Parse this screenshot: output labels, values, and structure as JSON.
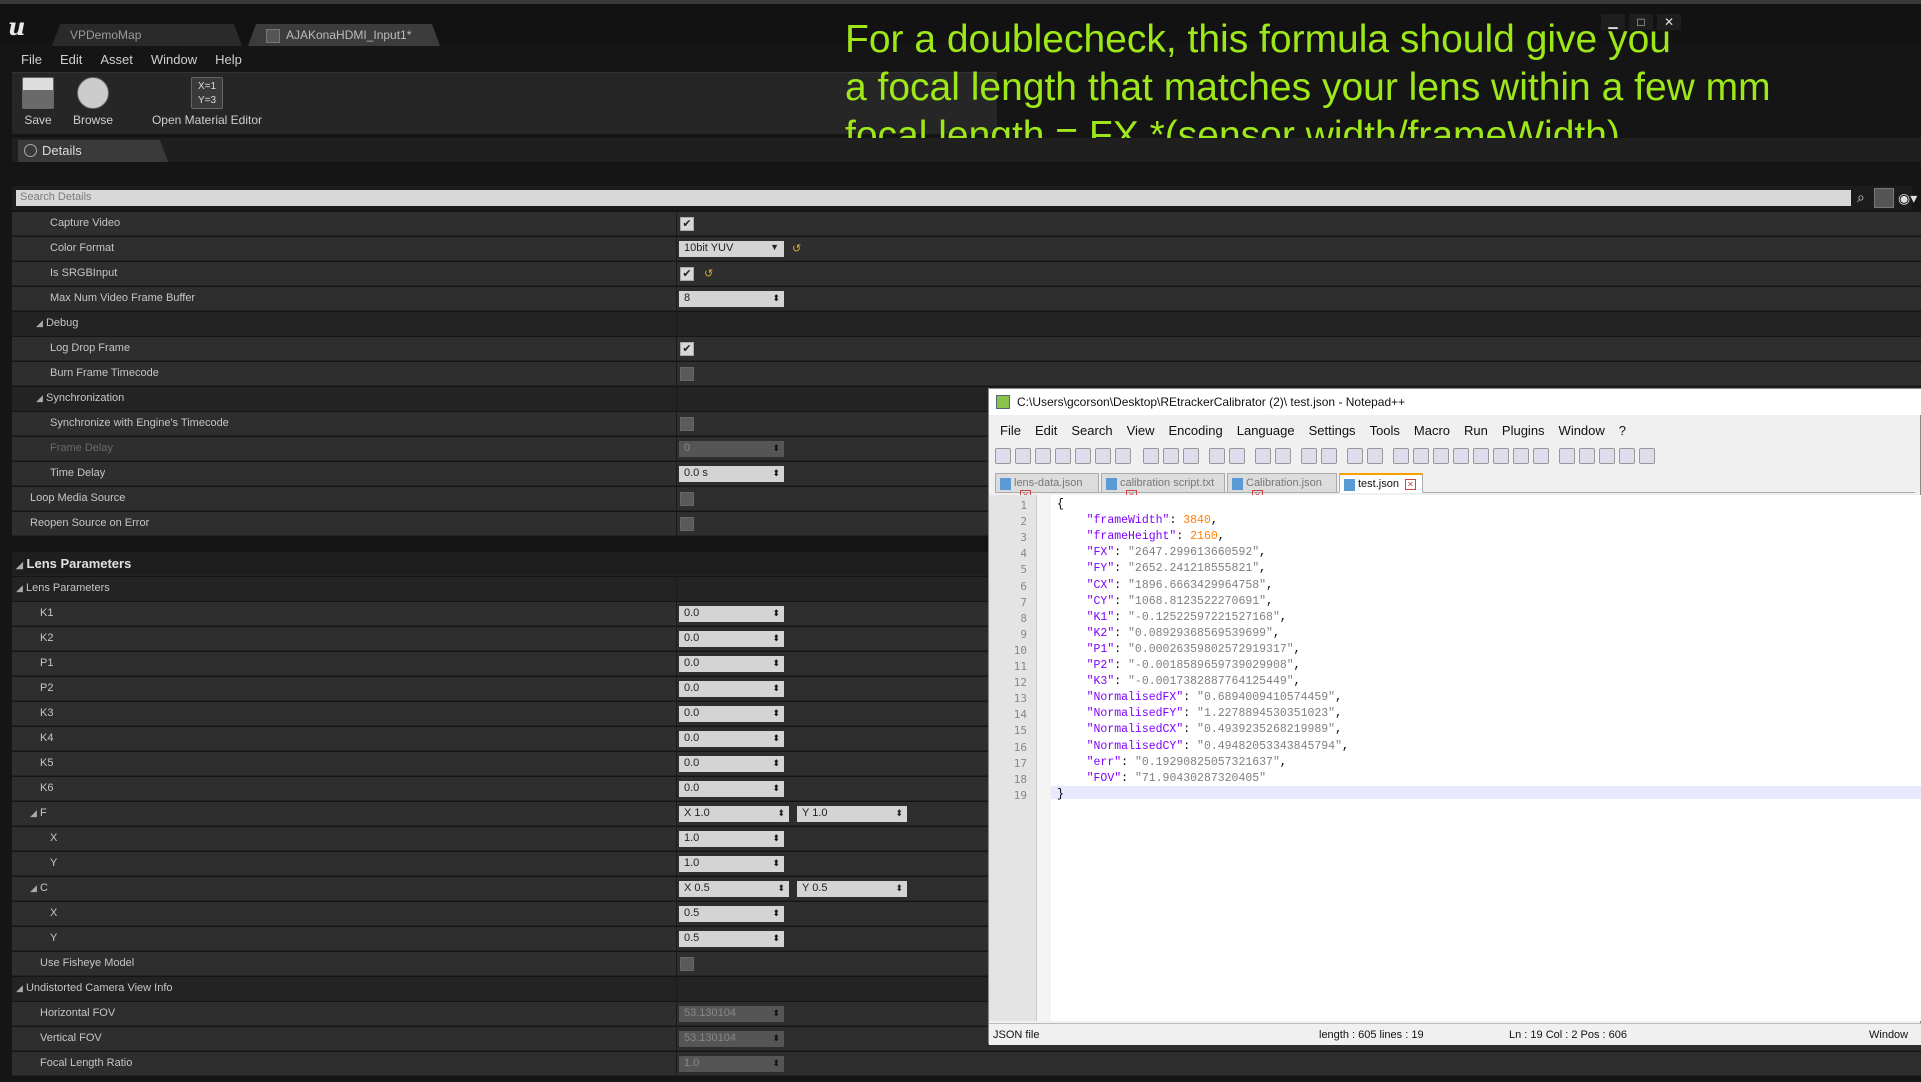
{
  "window": {
    "tabs": [
      {
        "label": "VPDemoMap"
      },
      {
        "label": "AJAKonaHDMI_Input1*"
      }
    ],
    "buttons": {
      "minimize": "▁",
      "maximize": "□",
      "close": "✕"
    }
  },
  "menu": [
    "File",
    "Edit",
    "Asset",
    "Window",
    "Help"
  ],
  "toolbar": {
    "save": "Save",
    "browse": "Browse",
    "open_material_editor": "Open Material Editor",
    "material_icon_text": "X=1\nY=3"
  },
  "details": {
    "tab_label": "Details",
    "search_placeholder": "Search Details"
  },
  "annotation": {
    "line1": "For a doublecheck, this formula should give you",
    "line2": "a focal length that matches your lens within a few mm",
    "line3": "focal length = FX *(sensor width/frameWidth)"
  },
  "props": {
    "capture_video": "Capture Video",
    "color_format": "Color Format",
    "color_format_value": "10bit YUV",
    "is_srgb": "Is SRGBInput",
    "max_buffer": "Max Num Video Frame Buffer",
    "max_buffer_value": "8",
    "debug": "Debug",
    "log_drop": "Log Drop Frame",
    "burn_tc": "Burn Frame Timecode",
    "sync": "Synchronization",
    "sync_engine": "Synchronize with Engine's Timecode",
    "frame_delay": "Frame Delay",
    "frame_delay_value": "0",
    "time_delay": "Time Delay",
    "time_delay_value": "0.0 s",
    "loop_media": "Loop Media Source",
    "reopen": "Reopen Source on Error",
    "lens_header": "Lens Parameters",
    "lens_cat": "Lens Parameters",
    "k1": "K1",
    "k2": "K2",
    "p1": "P1",
    "p2": "P2",
    "k3": "K3",
    "k4": "K4",
    "k5": "K5",
    "k6": "K6",
    "zero": "0.0",
    "f": "F",
    "f_x": "X 1.0",
    "f_y": "Y 1.0",
    "x": "X",
    "y": "Y",
    "one": "1.0",
    "c": "C",
    "c_x": "X 0.5",
    "c_y": "Y 0.5",
    "half": "0.5",
    "fisheye": "Use Fisheye Model",
    "undist": "Undistorted Camera View Info",
    "hfov": "Horizontal FOV",
    "hfov_value": "53.130104",
    "vfov": "Vertical FOV",
    "vfov_value": "53.130104",
    "flr": "Focal Length Ratio",
    "flr_value": "1.0"
  },
  "npp": {
    "title": "C:\\Users\\gcorson\\Desktop\\REtrackerCalibrator (2)\\ test.json - Notepad++",
    "menu": [
      "File",
      "Edit",
      "Search",
      "View",
      "Encoding",
      "Language",
      "Settings",
      "Tools",
      "Macro",
      "Run",
      "Plugins",
      "Window",
      "?"
    ],
    "tabs": [
      "lens-data.json",
      "calibration script.txt",
      "Calibration.json",
      "test.json"
    ],
    "lines": [
      {
        "n": "1",
        "t": "{"
      },
      {
        "n": "2",
        "k": "\"frameWidth\"",
        "v": "3840",
        "num": true
      },
      {
        "n": "3",
        "k": "\"frameHeight\"",
        "v": "2160",
        "num": true
      },
      {
        "n": "4",
        "k": "\"FX\"",
        "v": "\"2647.299613660592\""
      },
      {
        "n": "5",
        "k": "\"FY\"",
        "v": "\"2652.241218555821\""
      },
      {
        "n": "6",
        "k": "\"CX\"",
        "v": "\"1896.6663429964758\""
      },
      {
        "n": "7",
        "k": "\"CY\"",
        "v": "\"1068.8123522270691\""
      },
      {
        "n": "8",
        "k": "\"K1\"",
        "v": "\"-0.12522597221527168\""
      },
      {
        "n": "9",
        "k": "\"K2\"",
        "v": "\"0.08929368569539699\""
      },
      {
        "n": "10",
        "k": "\"P1\"",
        "v": "\"0.00026359802572919317\""
      },
      {
        "n": "11",
        "k": "\"P2\"",
        "v": "\"-0.0018589659739029908\""
      },
      {
        "n": "12",
        "k": "\"K3\"",
        "v": "\"-0.0017382887764125449\""
      },
      {
        "n": "13",
        "k": "\"NormalisedFX\"",
        "v": "\"0.6894009410574459\""
      },
      {
        "n": "14",
        "k": "\"NormalisedFY\"",
        "v": "\"1.2278894530351023\""
      },
      {
        "n": "15",
        "k": "\"NormalisedCX\"",
        "v": "\"0.4939235268219989\""
      },
      {
        "n": "16",
        "k": "\"NormalisedCY\"",
        "v": "\"0.49482053343845794\""
      },
      {
        "n": "17",
        "k": "\"err\"",
        "v": "\"0.19290825057321637\""
      },
      {
        "n": "18",
        "k": "\"FOV\"",
        "v": "\"71.90430287320405\"",
        "last": true
      },
      {
        "n": "19",
        "t": "}"
      }
    ],
    "status": {
      "type": "JSON file",
      "length": "length : 605    lines : 19",
      "pos": "Ln : 19    Col : 2    Pos : 606",
      "eol": "Window"
    }
  }
}
